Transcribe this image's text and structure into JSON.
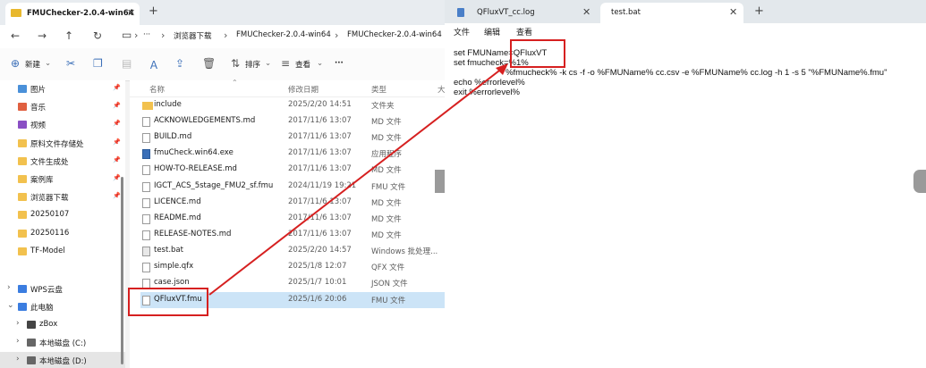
{
  "explorer": {
    "tab_title": "FMUChecker-2.0.4-win64",
    "tab_close": "✕",
    "new_tab": "+",
    "breadcrumb": [
      "浏览器下载",
      "FMUChecker-2.0.4-win64",
      "FMUChecker-2.0.4-win64"
    ],
    "toolbar": {
      "new_label": "新建",
      "sort_label": "排序",
      "view_label": "查看",
      "more_label": "···"
    },
    "sidebar": [
      {
        "label": "图片",
        "color": "#4a90d9",
        "pinned": true
      },
      {
        "label": "音乐",
        "color": "#e06040",
        "pinned": true
      },
      {
        "label": "视频",
        "color": "#8a4fc4",
        "pinned": true
      },
      {
        "label": "原料文件存储处",
        "color": "#f2c14e",
        "pinned": true
      },
      {
        "label": "文件生成处",
        "color": "#f2c14e",
        "pinned": true
      },
      {
        "label": "案例库",
        "color": "#f2c14e",
        "pinned": true
      },
      {
        "label": "浏览器下载",
        "color": "#f2c14e",
        "pinned": true
      },
      {
        "label": "20250107",
        "color": "#f2c14e",
        "pinned": false
      },
      {
        "label": "20250116",
        "color": "#f2c14e",
        "pinned": false
      },
      {
        "label": "TF-Model",
        "color": "#f2c14e",
        "pinned": false
      }
    ],
    "sidebar_tree": [
      {
        "label": "WPS云盘",
        "color": "#3b7de0"
      },
      {
        "label": "此电脑",
        "color": "#3b7de0"
      },
      {
        "label": "zBox",
        "color": "#444444"
      },
      {
        "label": "本地磁盘 (C:)",
        "color": "#666666"
      },
      {
        "label": "本地磁盘 (D:)",
        "color": "#666666"
      }
    ],
    "columns": {
      "name": "名称",
      "date": "修改日期",
      "type": "类型",
      "size": "大"
    },
    "files": [
      {
        "name": "include",
        "date": "2025/2/20 14:51",
        "type": "文件夹",
        "kind": "folder"
      },
      {
        "name": "ACKNOWLEDGEMENTS.md",
        "date": "2017/11/6 13:07",
        "type": "MD 文件",
        "kind": "file"
      },
      {
        "name": "BUILD.md",
        "date": "2017/11/6 13:07",
        "type": "MD 文件",
        "kind": "file"
      },
      {
        "name": "fmuCheck.win64.exe",
        "date": "2017/11/6 13:07",
        "type": "应用程序",
        "kind": "exe"
      },
      {
        "name": "HOW-TO-RELEASE.md",
        "date": "2017/11/6 13:07",
        "type": "MD 文件",
        "kind": "file"
      },
      {
        "name": "IGCT_ACS_5stage_FMU2_sf.fmu",
        "date": "2024/11/19 19:21",
        "type": "FMU 文件",
        "kind": "file"
      },
      {
        "name": "LICENCE.md",
        "date": "2017/11/6 13:07",
        "type": "MD 文件",
        "kind": "file"
      },
      {
        "name": "README.md",
        "date": "2017/11/6 13:07",
        "type": "MD 文件",
        "kind": "file"
      },
      {
        "name": "RELEASE-NOTES.md",
        "date": "2017/11/6 13:07",
        "type": "MD 文件",
        "kind": "file"
      },
      {
        "name": "test.bat",
        "date": "2025/2/20 14:57",
        "type": "Windows 批处理...",
        "kind": "bat"
      },
      {
        "name": "simple.qfx",
        "date": "2025/1/8 12:07",
        "type": "QFX 文件",
        "kind": "file"
      },
      {
        "name": "case.json",
        "date": "2025/1/7 10:01",
        "type": "JSON 文件",
        "kind": "file"
      },
      {
        "name": "QFluxVT.fmu",
        "date": "2025/1/6 20:06",
        "type": "FMU 文件",
        "kind": "file",
        "selected": true
      }
    ]
  },
  "notepad": {
    "tabs": [
      {
        "label": "QFluxVT_cc.log",
        "active": false
      },
      {
        "label": "test.bat",
        "active": true
      }
    ],
    "close": "✕",
    "new_tab": "+",
    "menu": [
      "文件",
      "编辑",
      "查看"
    ],
    "lines": [
      "set FMUName=QFluxVT",
      "set fmucheck=%1%",
      "                      %fmucheck% -k cs -f -o %FMUName% cc.csv -e %FMUName% cc.log -h 1 -s 5 \"%FMUName%.fmu\"",
      "echo %errorlevel%",
      "exit %errorlevel%"
    ]
  },
  "colors": {
    "annotation": "#d62020",
    "selection": "#cce4f7",
    "folder": "#f2c14e"
  }
}
